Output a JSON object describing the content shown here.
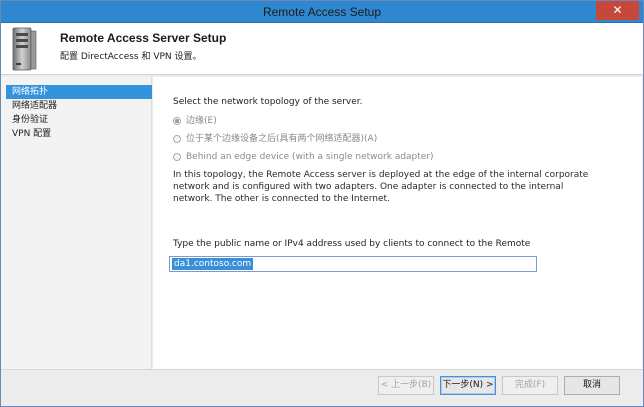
{
  "window": {
    "title": "Remote Access Setup",
    "close_glyph": "✕"
  },
  "header": {
    "title": "Remote Access Server Setup",
    "subtitle": "配置 DirectAccess 和 VPN 设置。",
    "icon": "server-tower-icon"
  },
  "nav": {
    "items": [
      {
        "label": "网络拓扑",
        "active": true
      },
      {
        "label": "网络适配器",
        "active": false
      },
      {
        "label": "身份验证",
        "active": false
      },
      {
        "label": "VPN 配置",
        "active": false
      }
    ]
  },
  "main": {
    "prompt": "Select the network topology of the server.",
    "options": [
      {
        "label": "边缘(E)",
        "checked": true
      },
      {
        "label": "位于某个边缘设备之后(具有两个网络适配器)(A)",
        "checked": false
      },
      {
        "label": "Behind an edge device (with a single network adapter)",
        "checked": false
      }
    ],
    "description": "In this topology, the Remote Access server is deployed at the edge of the internal corporate network and is configured with two adapters. One adapter is connected to the internal network. The other is connected to the Internet.",
    "input_label": "Type the public name or IPv4 address used by clients to connect to the Remote",
    "input_value": "da1.contoso.com"
  },
  "footer": {
    "back": "< 上一步(B)",
    "next": "下一步(N) >",
    "finish": "完成(F)",
    "cancel": "取消"
  },
  "colors": {
    "titlebar": "#2f88cf",
    "close": "#c7473b",
    "nav_active": "#3393dc",
    "selection": "#3a8fd9"
  }
}
